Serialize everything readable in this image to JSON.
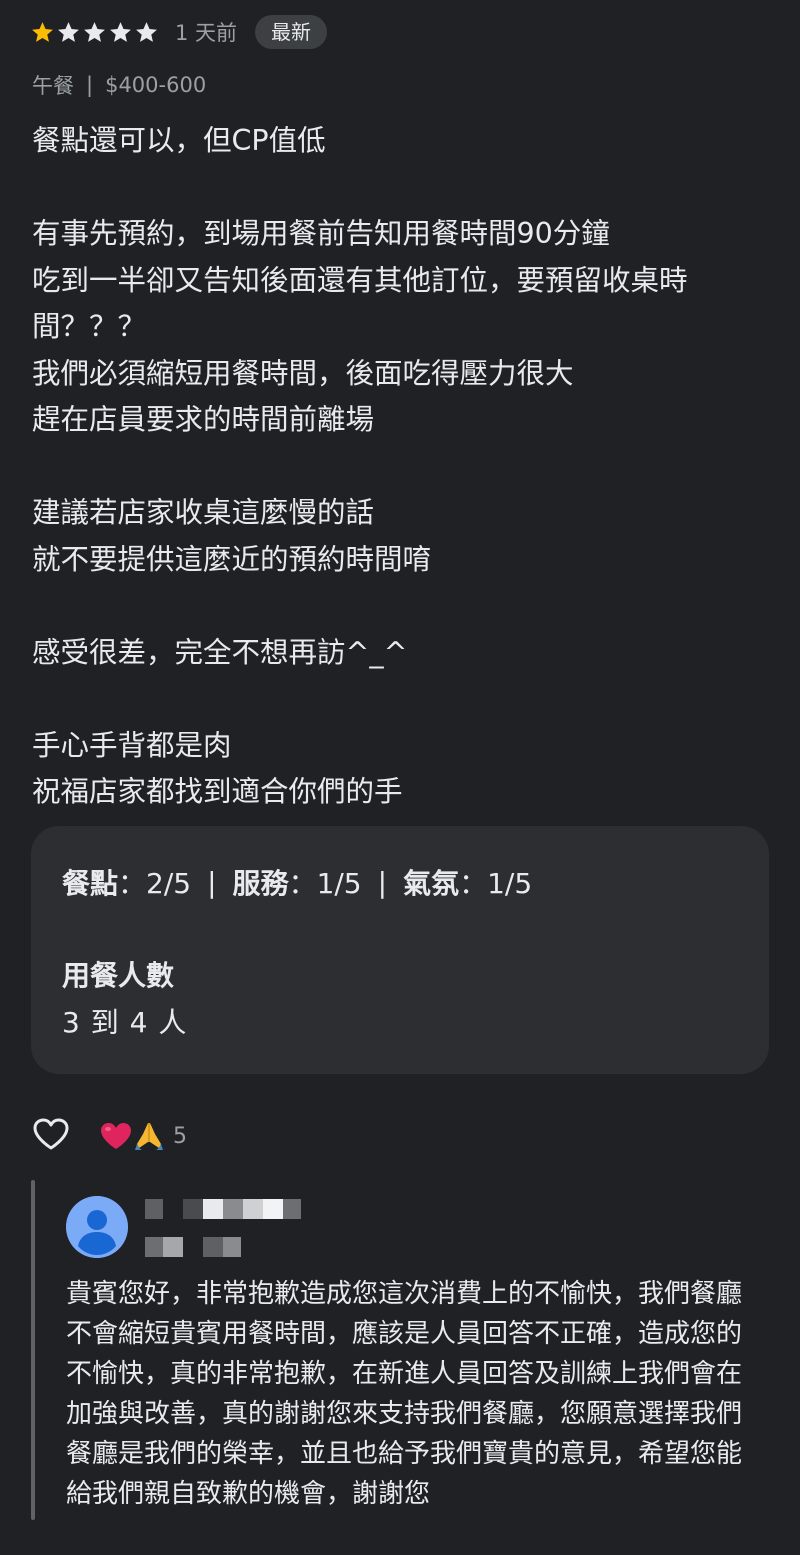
{
  "review": {
    "rating": 1,
    "max_rating": 5,
    "time_ago": "1 天前",
    "badge": "最新",
    "meal_type": "午餐",
    "meta_separator": "|",
    "price_range": "$400-600",
    "body_lines": [
      "餐點還可以，但CP值低",
      "",
      "有事先預約，到場用餐前告知用餐時間90分鐘",
      "吃到一半卻又告知後面還有其他訂位，要預留收桌時",
      "間？？？",
      "我們必須縮短用餐時間，後面吃得壓力很大",
      "趕在店員要求的時間前離場",
      "",
      "建議若店家收桌這麼慢的話",
      "就不要提供這麼近的預約時間唷",
      "",
      "感受很差，完全不想再訪^_^",
      "",
      "手心手背都是肉",
      "祝福店家都找到適合你們的手"
    ]
  },
  "attributes": {
    "ratings": [
      {
        "label": "餐點",
        "value": "2/5"
      },
      {
        "label": "服務",
        "value": "1/5"
      },
      {
        "label": "氣氛",
        "value": "1/5"
      }
    ],
    "label_value_separator": "：",
    "item_separator": "|",
    "party_size_title": "用餐人數",
    "party_size_value": "3 到 4 人"
  },
  "reactions": {
    "like_icon": "heart-outline-icon",
    "emojis": [
      "heart-emoji",
      "pray-emoji"
    ],
    "count": "5"
  },
  "owner_reply": {
    "avatar_icon": "person-avatar-icon",
    "body_lines": [
      "貴賓您好，非常抱歉造成您這次消費上的不愉快，我們餐廳",
      "不會縮短貴賓用餐時間，應該是人員回答不正確，造成您的",
      "不愉快，真的非常抱歉，在新進人員回答及訓練上我們會在",
      "加強與改善，真的謝謝您來支持我們餐廳，您願意選擇我們",
      "餐廳是我們的榮幸，並且也給予我們寶貴的意見，希望您能",
      "給我們親自致歉的機會，謝謝您"
    ]
  },
  "colors": {
    "background": "#202124",
    "card": "#2d2e31",
    "text_primary": "#e8eaed",
    "text_secondary": "#9aa0a6",
    "star_filled": "#fbbc04",
    "star_empty": "#e8eaed",
    "avatar": "#7baaf7"
  }
}
